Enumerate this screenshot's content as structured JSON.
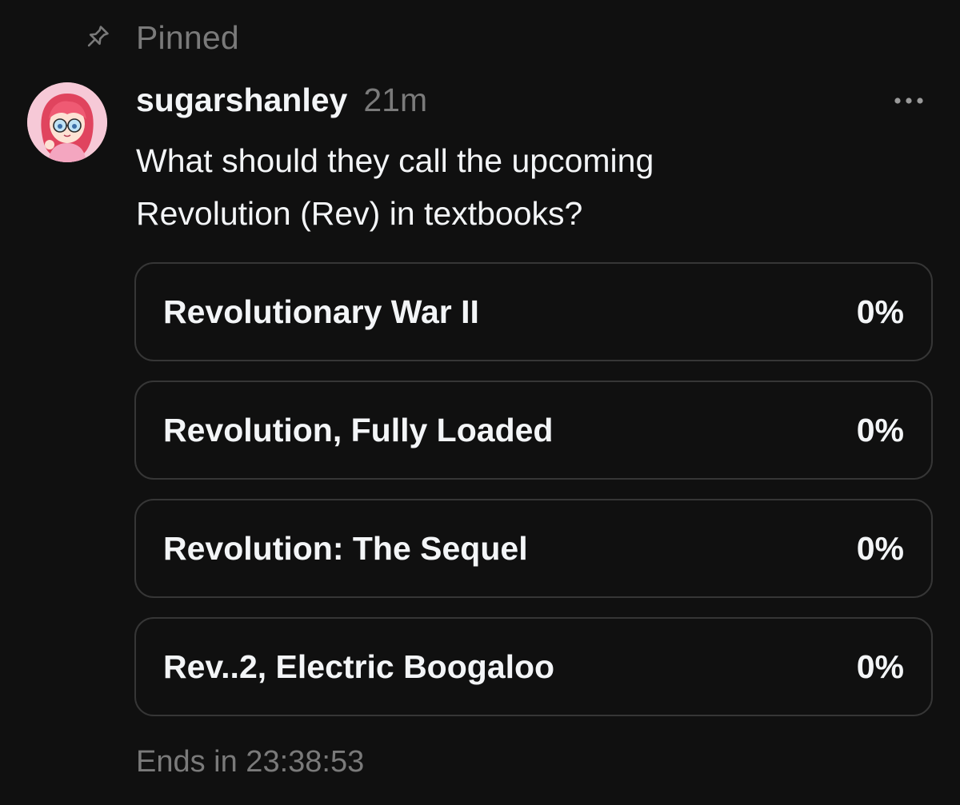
{
  "pinned": {
    "label": "Pinned",
    "icon": "pin-icon"
  },
  "post": {
    "username": "sugarshanley",
    "timestamp": "21m",
    "avatar_icon": "avatar",
    "more_icon": "more-horizontal-icon",
    "text_line1": "What should they call the upcoming",
    "text_line2": "Revolution (Rev) in textbooks?",
    "poll": {
      "options": [
        {
          "label": "Revolutionary War II",
          "percent": "0%"
        },
        {
          "label": "Revolution, Fully Loaded",
          "percent": "0%"
        },
        {
          "label": "Revolution: The Sequel",
          "percent": "0%"
        },
        {
          "label": "Rev..2, Electric Boogaloo",
          "percent": "0%"
        }
      ],
      "ends_text": "Ends in 23:38:53"
    }
  },
  "colors": {
    "background": "#101010",
    "primary_text": "#f3f5f7",
    "secondary_text": "#7a7a7a",
    "option_border": "#363636"
  }
}
